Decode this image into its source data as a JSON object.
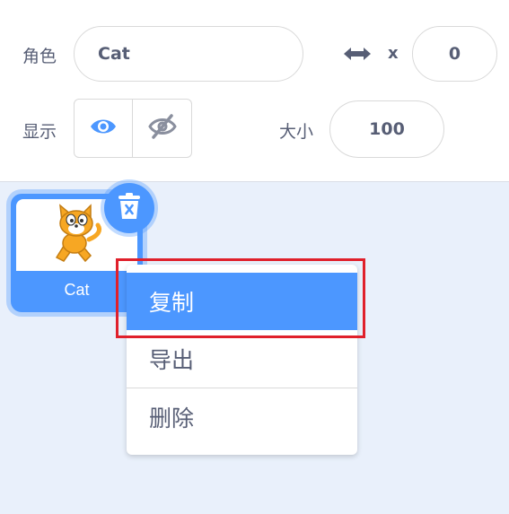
{
  "sprite_info": {
    "sprite_label": "角色",
    "sprite_name_value": "Cat",
    "x_label": "x",
    "x_value": "0",
    "show_label": "显示",
    "size_label": "大小",
    "size_value": "100"
  },
  "sprite_list": {
    "items": [
      {
        "name": "Cat"
      }
    ]
  },
  "context_menu": {
    "items": [
      {
        "label": "复制"
      },
      {
        "label": "导出"
      },
      {
        "label": "删除"
      }
    ]
  },
  "colors": {
    "accent": "#4c97ff",
    "highlight_box": "#e0202b",
    "pane_background": "#e9f0fb"
  }
}
